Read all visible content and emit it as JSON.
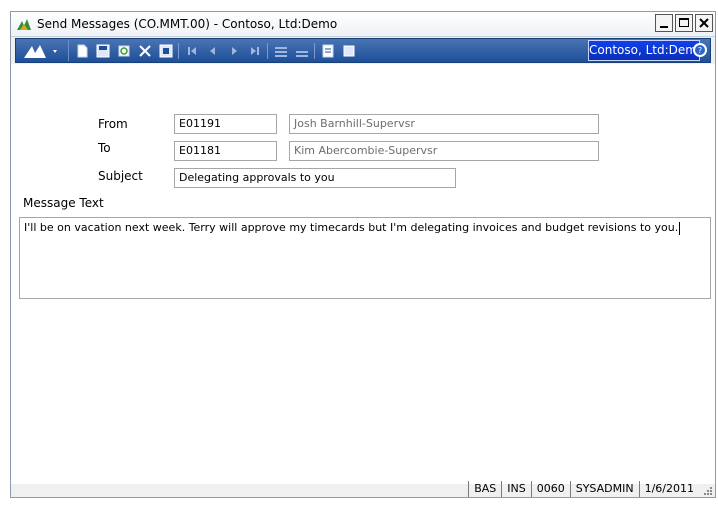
{
  "window": {
    "title": "Send Messages (CO.MMT.00) - Contoso, Ltd:Demo"
  },
  "toolbar": {
    "company": "Contoso, Ltd:Demo",
    "icons": [
      "new-icon",
      "save-icon",
      "refresh-icon",
      "delete-icon",
      "cancel-icon",
      "first-icon",
      "previous-icon",
      "next-icon",
      "last-icon",
      "insert-row-icon",
      "delete-row-icon",
      "notes-icon",
      "attachments-icon",
      "help-icon"
    ]
  },
  "form": {
    "from_label": "From",
    "from_id": "E01191",
    "from_name": "Josh Barnhill-Supervsr",
    "to_label": "To",
    "to_id": "E01181",
    "to_name": "Kim Abercombie-Supervsr",
    "subject_label": "Subject",
    "subject": "Delegating approvals to you",
    "message_label": "Message Text",
    "message": "I'll be on vacation next week. Terry will approve my timecards but I'm delegating invoices and budget revisions to you."
  },
  "status": {
    "items": [
      "BAS",
      "INS",
      "0060",
      "SYSADMIN",
      "1/6/2011"
    ]
  },
  "colors": {
    "toolbar": "#1e4f98",
    "company": "#0a2fb8"
  }
}
